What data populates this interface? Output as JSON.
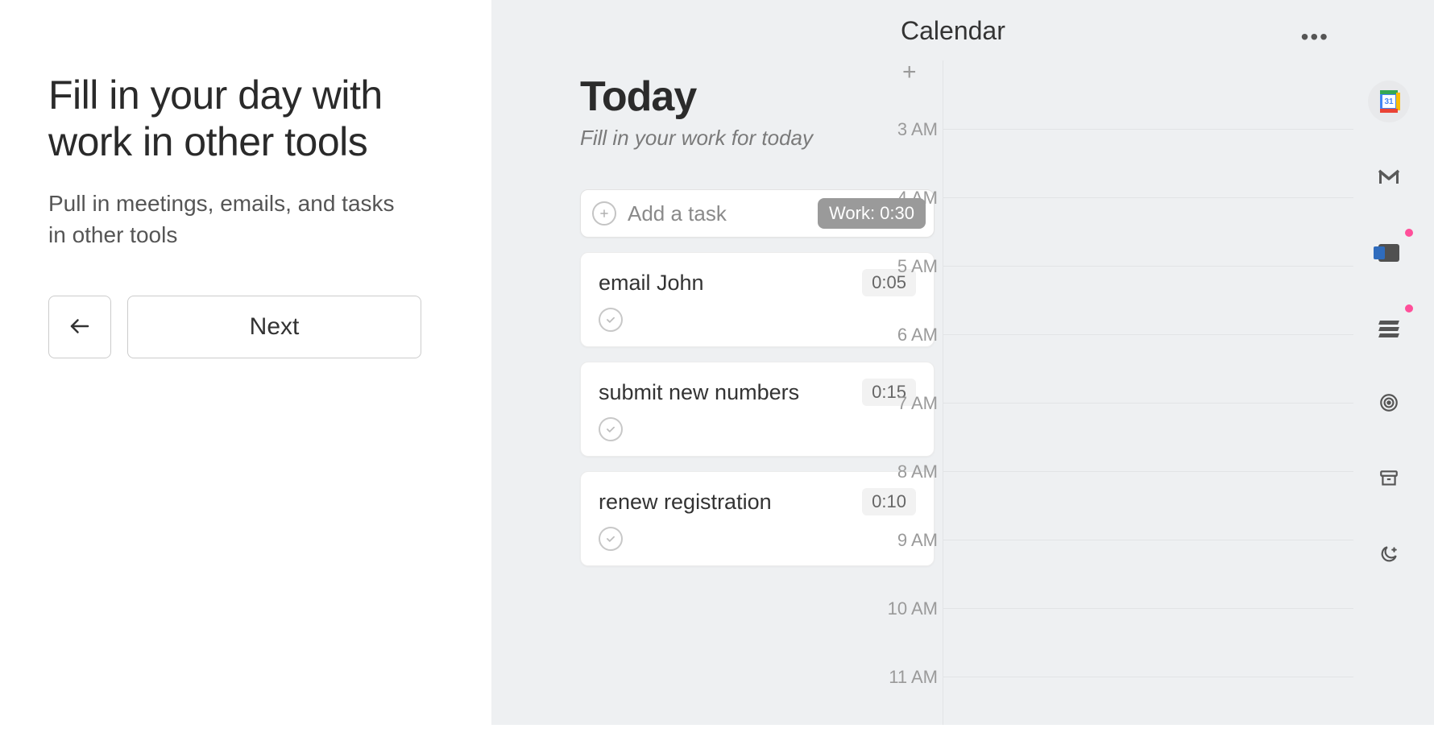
{
  "onboarding": {
    "title": "Fill in your day with work in other tools",
    "subtitle": "Pull in meetings, emails, and tasks in other tools",
    "next_label": "Next"
  },
  "today": {
    "title": "Today",
    "subtitle": "Fill in your work for today",
    "add_task_label": "Add a task",
    "work_badge": "Work: 0:30",
    "tasks": [
      {
        "title": "email John",
        "duration": "0:05"
      },
      {
        "title": "submit new numbers",
        "duration": "0:15"
      },
      {
        "title": "renew registration",
        "duration": "0:10"
      }
    ]
  },
  "calendar": {
    "title": "Calendar",
    "hours": [
      "3 AM",
      "4 AM",
      "5 AM",
      "6 AM",
      "7 AM",
      "8 AM",
      "9 AM",
      "10 AM",
      "11 AM"
    ]
  },
  "rail": {
    "items": [
      {
        "name": "google-calendar",
        "active": true,
        "dot": false
      },
      {
        "name": "gmail",
        "active": false,
        "dot": false
      },
      {
        "name": "outlook",
        "active": false,
        "dot": true
      },
      {
        "name": "todoist",
        "active": false,
        "dot": true
      },
      {
        "name": "focus-target",
        "active": false,
        "dot": false
      },
      {
        "name": "archive",
        "active": false,
        "dot": false
      },
      {
        "name": "night-mode",
        "active": false,
        "dot": false
      }
    ]
  }
}
